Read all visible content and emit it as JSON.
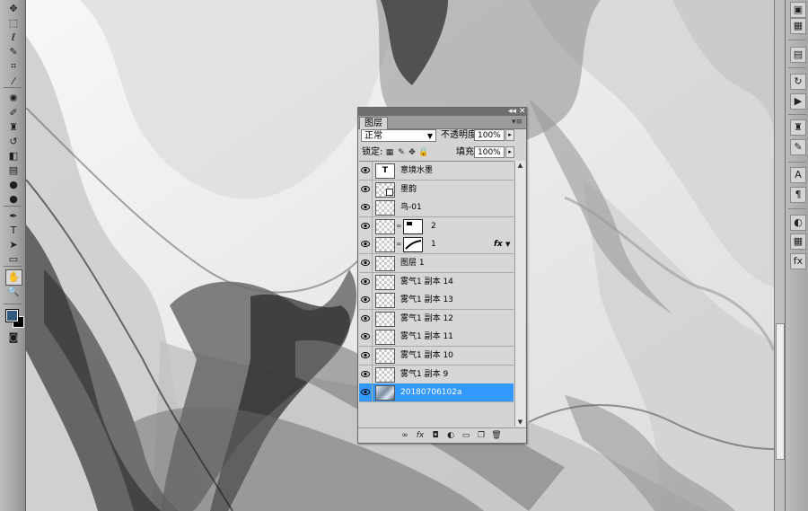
{
  "toolbar": {
    "tools": [
      {
        "name": "move-tool-icon",
        "glyph": "✥"
      },
      {
        "name": "marquee-tool-icon",
        "glyph": "⬚"
      },
      {
        "name": "lasso-tool-icon",
        "glyph": "ℓ"
      },
      {
        "name": "quick-select-tool-icon",
        "glyph": "✎"
      },
      {
        "name": "crop-tool-icon",
        "glyph": "⌗"
      },
      {
        "name": "eyedropper-tool-icon",
        "glyph": "⁄"
      },
      {
        "name": "healing-brush-tool-icon",
        "glyph": "✺"
      },
      {
        "name": "brush-tool-icon",
        "glyph": "✐"
      },
      {
        "name": "clone-stamp-tool-icon",
        "glyph": "♜"
      },
      {
        "name": "history-brush-tool-icon",
        "glyph": "↺"
      },
      {
        "name": "eraser-tool-icon",
        "glyph": "◧"
      },
      {
        "name": "gradient-tool-icon",
        "glyph": "▤"
      },
      {
        "name": "blur-tool-icon",
        "glyph": "●"
      },
      {
        "name": "dodge-tool-icon",
        "glyph": "●"
      },
      {
        "name": "pen-tool-icon",
        "glyph": "✒"
      },
      {
        "name": "type-tool-icon",
        "glyph": "T"
      },
      {
        "name": "path-selection-tool-icon",
        "glyph": "➤"
      },
      {
        "name": "shape-tool-icon",
        "glyph": "▭"
      },
      {
        "name": "hand-tool-icon",
        "glyph": "✋"
      },
      {
        "name": "zoom-tool-icon",
        "glyph": "🔍"
      }
    ],
    "foreground_color": "#365a7e",
    "background_color": "#000000"
  },
  "layers_panel": {
    "tab_label": "图层",
    "blend_mode": "正常",
    "opacity_label": "不透明度:",
    "opacity_value": "100%",
    "lock_label": "锁定:",
    "fill_label": "填充:",
    "fill_value": "100%",
    "fx_label": "fx",
    "layers": [
      {
        "name": "意境水墨",
        "thumb": "text",
        "thumb_text": "T",
        "selected": false
      },
      {
        "name": "墨韵",
        "thumb": "smart",
        "selected": false
      },
      {
        "name": "鸟-01",
        "thumb": "checker",
        "selected": false
      },
      {
        "name": "2",
        "thumb": "checker",
        "mask": true,
        "selected": false
      },
      {
        "name": "1",
        "thumb": "checker",
        "mask": true,
        "fx": true,
        "selected": false
      },
      {
        "name": "图层 1",
        "thumb": "checker",
        "selected": false
      },
      {
        "name": "雾气1 副本 14",
        "thumb": "checker",
        "selected": false
      },
      {
        "name": "雾气1 副本 13",
        "thumb": "checker",
        "selected": false
      },
      {
        "name": "雾气1 副本 12",
        "thumb": "checker",
        "selected": false
      },
      {
        "name": "雾气1 副本 11",
        "thumb": "checker",
        "selected": false
      },
      {
        "name": "雾气1 副本 10",
        "thumb": "checker",
        "selected": false
      },
      {
        "name": "雾气1 副本 9",
        "thumb": "checker",
        "selected": false
      },
      {
        "name": "20180706102a",
        "thumb": "photo",
        "selected": true
      }
    ]
  },
  "dock": {
    "buttons": [
      {
        "name": "navigator-panel-icon",
        "glyph": "▣"
      },
      {
        "name": "histogram-panel-icon",
        "glyph": "▦"
      },
      {
        "name": "info-panel-icon",
        "glyph": "▤"
      },
      {
        "name": "history-panel-icon",
        "glyph": "↻"
      },
      {
        "name": "actions-panel-icon",
        "glyph": "▶"
      },
      {
        "name": "clone-source-panel-icon",
        "glyph": "♜"
      },
      {
        "name": "brushes-panel-icon",
        "glyph": "✎"
      },
      {
        "name": "character-panel-icon",
        "glyph": "A"
      },
      {
        "name": "paragraph-panel-icon",
        "glyph": "¶"
      },
      {
        "name": "color-panel-icon",
        "glyph": "◐"
      },
      {
        "name": "swatches-panel-icon",
        "glyph": "▦"
      },
      {
        "name": "styles-panel-icon",
        "glyph": "fx"
      }
    ]
  }
}
